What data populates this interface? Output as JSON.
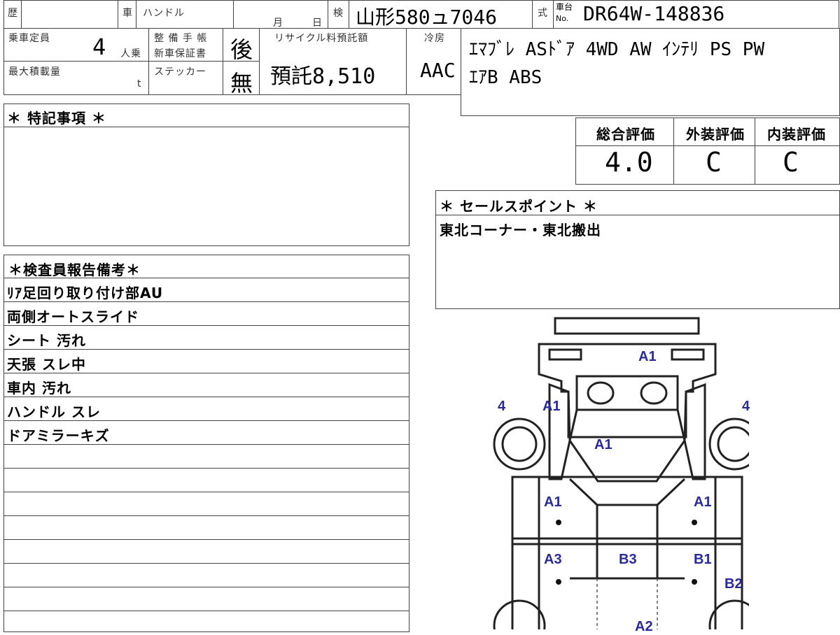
{
  "header": {
    "history_label": "歴",
    "car_label": "車",
    "handle_label": "ハンドル",
    "month_label": "月",
    "day_label": "日",
    "inspection_label": "検",
    "plate": "山形580ュ7046",
    "type_label": "式",
    "chassis_label_top": "車台",
    "chassis_label_no": "No.",
    "chassis_no": "DR64W-148836"
  },
  "specs": {
    "capacity_label": "乗車定員",
    "capacity_value": "4",
    "capacity_unit": "人乗",
    "maxload_label": "最大積載量",
    "maxload_unit": "t",
    "maintenance_label": "整 備 手 帳",
    "warranty_label": "新車保証書",
    "maintenance_value": "後",
    "sticker_label": "ステッカー",
    "sticker_value": "無",
    "recycle_label": "リサイクル料預託額",
    "recycle_value": "預託8,510",
    "ac_label": "冷房",
    "ac_value": "AAC"
  },
  "equipment": {
    "line1": "ｴﾏﾌﾞﾚ ASﾄﾞｱ 4WD AW ｲﾝﾃﾘ PS PW",
    "line2": "ｴｱB ABS"
  },
  "ratings": {
    "overall_label": "総合評価",
    "exterior_label": "外装評価",
    "interior_label": "内装評価",
    "overall_value": "4.0",
    "exterior_value": "C",
    "interior_value": "C"
  },
  "special_notes": {
    "title": "＊ 特記事項 ＊"
  },
  "sales_point": {
    "title": "＊ セールスポイント ＊",
    "text": "東北コーナー・東北搬出"
  },
  "inspector_report": {
    "title": "＊検査員報告備考＊",
    "lines": [
      "ﾘｱ足回り取り付け部AU",
      "両側オートスライド",
      "シート 汚れ",
      "天張 スレ中",
      "車内 汚れ",
      "ハンドル スレ",
      "ドアミラーキズ"
    ]
  },
  "damage_map": {
    "front_bumper": "A1",
    "front_left_wheel": "4",
    "front_left_fender": "A1",
    "front_right_wheel": "4",
    "hood": "A1",
    "left_front_door": "A1",
    "right_front_door": "A1",
    "left_rear_door": "A3",
    "roof": "B3",
    "right_rear_door": "B1",
    "right_rear_quarter": "B2",
    "rear_partial": "A2"
  }
}
